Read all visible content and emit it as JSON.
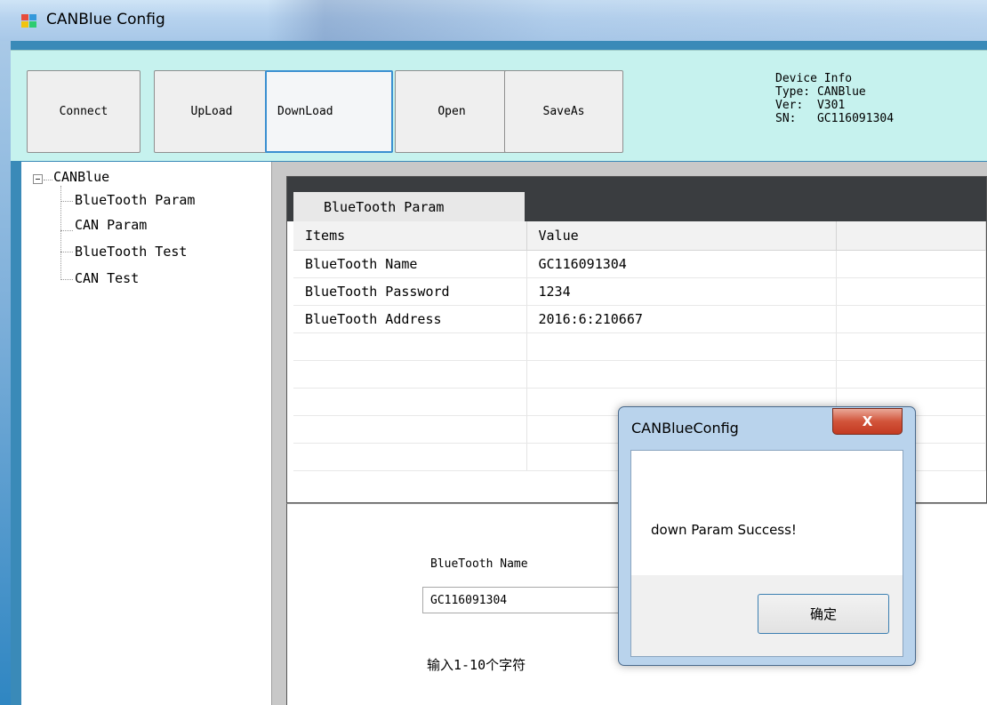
{
  "window": {
    "title": "CANBlue Config"
  },
  "toolbar": {
    "buttons": [
      {
        "label": "Connect"
      },
      {
        "label": "UpLoad"
      },
      {
        "label": "DownLoad"
      },
      {
        "label": "Open"
      },
      {
        "label": "SaveAs"
      }
    ],
    "device_info": {
      "heading": "Device Info",
      "type_line": "Type: CANBlue",
      "ver_line": "Ver:  V301",
      "sn_line": "SN:   GC116091304"
    }
  },
  "tree": {
    "root": "CANBlue",
    "children": [
      "BlueTooth Param",
      "CAN Param",
      "BlueTooth Test",
      "CAN Test"
    ]
  },
  "grid": {
    "title": "BlueTooth Param",
    "columns": [
      "Items",
      "Value",
      ""
    ],
    "rows": [
      [
        "BlueTooth Name",
        "GC116091304",
        ""
      ],
      [
        "BlueTooth Password",
        "1234",
        ""
      ],
      [
        "BlueTooth Address",
        "2016:6:210667",
        ""
      ],
      [
        "",
        "",
        ""
      ],
      [
        "",
        "",
        ""
      ],
      [
        "",
        "",
        ""
      ],
      [
        "",
        "",
        ""
      ],
      [
        "",
        "",
        ""
      ]
    ]
  },
  "edit": {
    "label": "BlueTooth Name",
    "value": "GC116091304",
    "hint": "输入1-10个字符"
  },
  "dialog": {
    "title": "CANBlueConfig",
    "close_glyph": "X",
    "message": "down Param Success!",
    "ok_label": "确定"
  }
}
